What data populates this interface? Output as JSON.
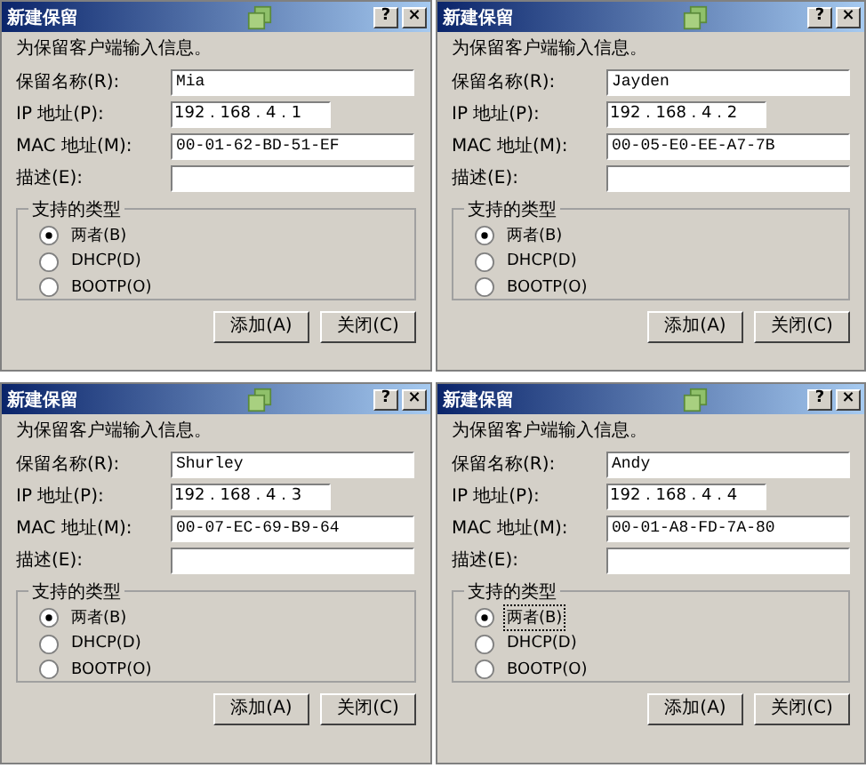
{
  "dialogs": [
    {
      "title": "新建保留",
      "help": "?",
      "close": "×",
      "intro": "为保留客户端输入信息。",
      "fields": [
        {
          "label": "保留名称(R):",
          "value": "Mia",
          "kind": "text"
        },
        {
          "label": "IP 地址(P):",
          "value": "192 . 168 . 4 . 1",
          "kind": "ip"
        },
        {
          "label": "MAC 地址(M):",
          "value": "00-01-62-BD-51-EF",
          "kind": "text"
        },
        {
          "label": "描述(E):",
          "kind": "text"
        }
      ],
      "group": {
        "title": "支持的类型",
        "options": [
          {
            "label": "两者(B)",
            "selected": true,
            "focused": false
          },
          {
            "label": "DHCP(D)",
            "selected": false,
            "focused": false
          },
          {
            "label": "BOOTP(O)",
            "selected": false,
            "focused": false
          }
        ]
      },
      "buttons": [
        "添加(A)",
        "关闭(C)"
      ]
    },
    {
      "title": "新建保留",
      "help": "?",
      "close": "×",
      "intro": "为保留客户端输入信息。",
      "fields": [
        {
          "label": "保留名称(R):",
          "value": "Jayden",
          "kind": "text"
        },
        {
          "label": "IP 地址(P):",
          "value": "192 . 168 . 4 . 2",
          "kind": "ip"
        },
        {
          "label": "MAC 地址(M):",
          "value": "00-05-E0-EE-A7-7B",
          "kind": "text"
        },
        {
          "label": "描述(E):",
          "kind": "text"
        }
      ],
      "group": {
        "title": "支持的类型",
        "options": [
          {
            "label": "两者(B)",
            "selected": true,
            "focused": false
          },
          {
            "label": "DHCP(D)",
            "selected": false,
            "focused": false
          },
          {
            "label": "BOOTP(O)",
            "selected": false,
            "focused": false
          }
        ]
      },
      "buttons": [
        "添加(A)",
        "关闭(C)"
      ]
    },
    {
      "title": "新建保留",
      "help": "?",
      "close": "×",
      "intro": "为保留客户端输入信息。",
      "fields": [
        {
          "label": "保留名称(R):",
          "value": "Shurley",
          "kind": "text"
        },
        {
          "label": "IP 地址(P):",
          "value": "192 . 168 . 4 . 3",
          "kind": "ip"
        },
        {
          "label": "MAC 地址(M):",
          "value": "00-07-EC-69-B9-64",
          "kind": "text"
        },
        {
          "label": "描述(E):",
          "kind": "text"
        }
      ],
      "group": {
        "title": "支持的类型",
        "options": [
          {
            "label": "两者(B)",
            "selected": true,
            "focused": false
          },
          {
            "label": "DHCP(D)",
            "selected": false,
            "focused": false
          },
          {
            "label": "BOOTP(O)",
            "selected": false,
            "focused": false
          }
        ]
      },
      "buttons": [
        "添加(A)",
        "关闭(C)"
      ]
    },
    {
      "title": "新建保留",
      "help": "?",
      "close": "×",
      "intro": "为保留客户端输入信息。",
      "fields": [
        {
          "label": "保留名称(R):",
          "value": "Andy",
          "kind": "text"
        },
        {
          "label": "IP 地址(P):",
          "value": "192 . 168 . 4 . 4",
          "kind": "ip"
        },
        {
          "label": "MAC 地址(M):",
          "value": "00-01-A8-FD-7A-80",
          "kind": "text"
        },
        {
          "label": "描述(E):",
          "kind": "text"
        }
      ],
      "group": {
        "title": "支持的类型",
        "options": [
          {
            "label": "两者(B)",
            "selected": true,
            "focused": true
          },
          {
            "label": "DHCP(D)",
            "selected": false,
            "focused": false
          },
          {
            "label": "BOOTP(O)",
            "selected": false,
            "focused": false
          }
        ]
      },
      "buttons": [
        "添加(A)",
        "关闭(C)"
      ]
    }
  ]
}
